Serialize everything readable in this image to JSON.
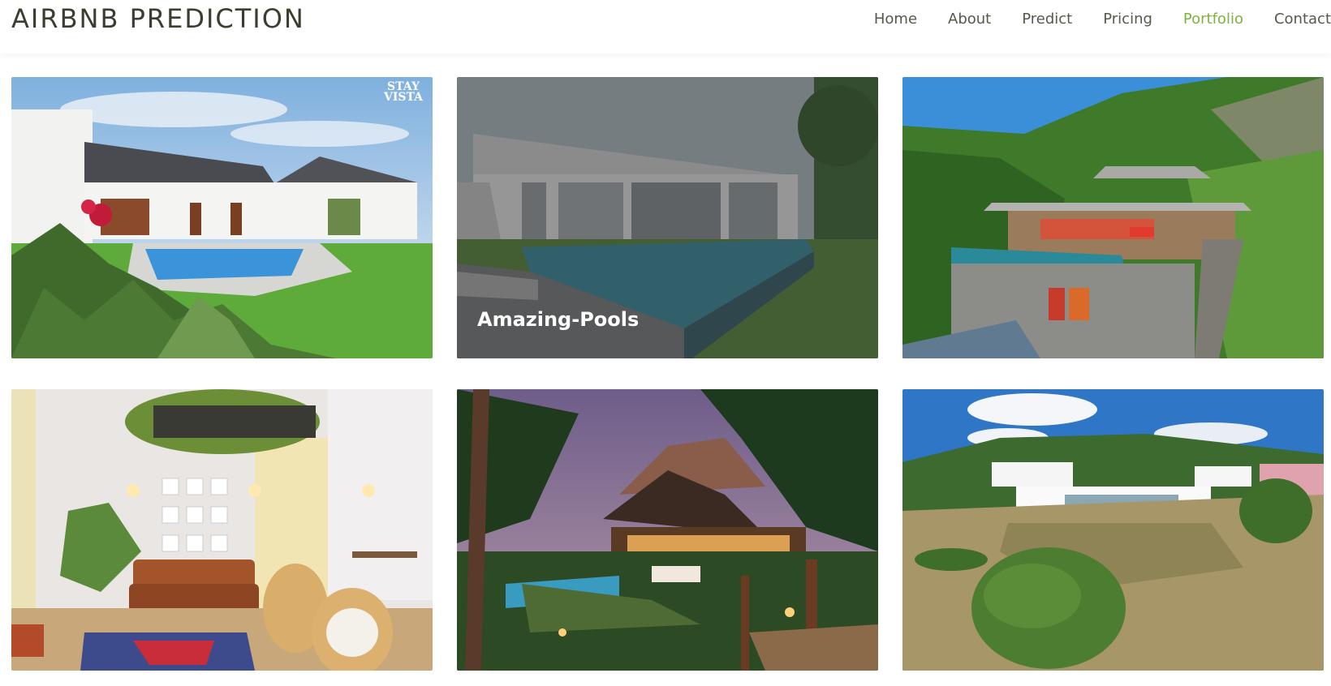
{
  "header": {
    "brand": "AIRBNB PREDICTION",
    "nav": [
      "Home",
      "About",
      "Predict",
      "Pricing",
      "Portfolio",
      "Contact"
    ],
    "active": "Portfolio",
    "accent_color": "#7fb23e"
  },
  "portfolio": {
    "cards": [
      {
        "watermark": "STAY VISTA"
      },
      {
        "caption": "Amazing-Pools"
      },
      {},
      {},
      {},
      {}
    ]
  }
}
